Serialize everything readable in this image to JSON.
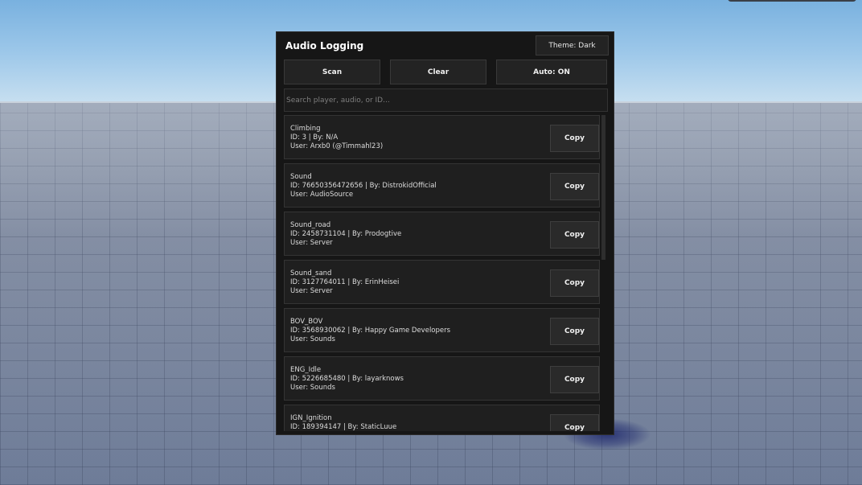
{
  "panel": {
    "title": "Audio Logging",
    "theme_label": "Theme: Dark"
  },
  "toolbar": {
    "scan_label": "Scan",
    "clear_label": "Clear",
    "auto_label": "Auto: ON"
  },
  "search": {
    "placeholder": "Search player, audio, or ID..."
  },
  "copy_label": "Copy",
  "entries": [
    {
      "name": "Climbing",
      "details": "ID: 3 | By: N/A",
      "user": "User: Arxb0 (@Timmahl23)"
    },
    {
      "name": "Sound",
      "details": "ID: 76650356472656 | By: DistrokidOfficial",
      "user": "User: AudioSource"
    },
    {
      "name": "Sound_road",
      "details": "ID: 2458731104 | By: Prodogtive",
      "user": "User: Server"
    },
    {
      "name": "Sound_sand",
      "details": "ID: 3127764011 | By: ErinHeisei",
      "user": "User: Server"
    },
    {
      "name": "BOV_BOV",
      "details": "ID: 3568930062 | By: Happy Game Developers",
      "user": "User: Sounds"
    },
    {
      "name": "ENG_Idle",
      "details": "ID: 5226685480 | By: layarknows",
      "user": "User: Sounds"
    },
    {
      "name": "IGN_Ignition",
      "details": "ID: 189394147 | By: StaticLuue",
      "user": ""
    }
  ]
}
